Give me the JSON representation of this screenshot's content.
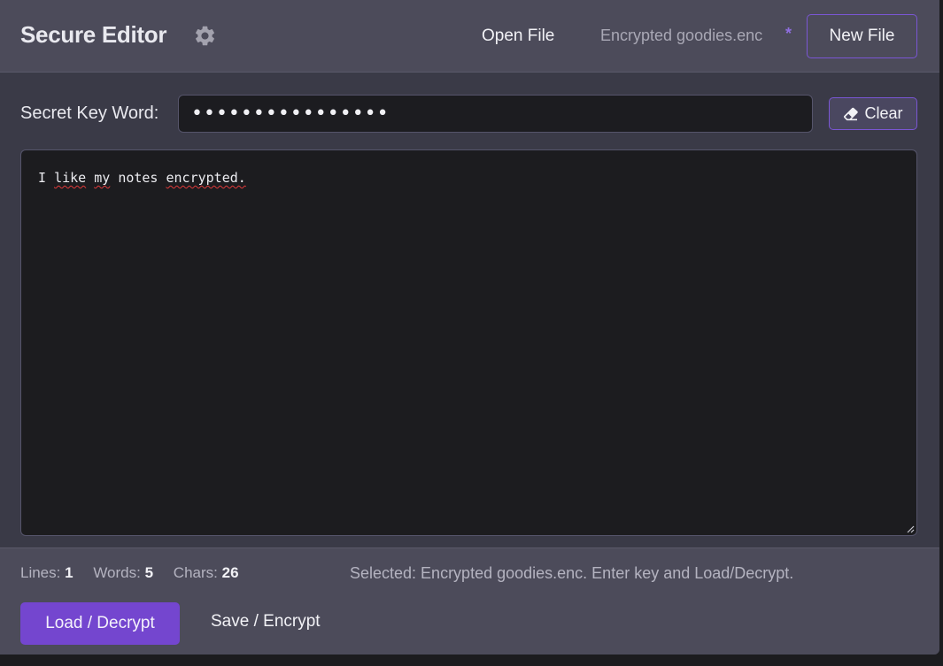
{
  "header": {
    "title": "Secure Editor",
    "settings_icon": "gear-icon",
    "open_file_label": "Open File",
    "current_file": "Encrypted goodies.enc",
    "modified_marker": "*",
    "new_file_label": "New File"
  },
  "key": {
    "label": "Secret Key Word:",
    "value_masked": "••••••••••••••••",
    "clear_label": "Clear",
    "clear_icon": "eraser-icon"
  },
  "editor": {
    "words": [
      "I",
      "like",
      "my",
      "notes",
      "encrypted."
    ],
    "misspelled": [
      "like",
      "my",
      "encrypted"
    ]
  },
  "footer": {
    "lines_label": "Lines:",
    "lines_value": "1",
    "words_label": "Words:",
    "words_value": "5",
    "chars_label": "Chars:",
    "chars_value": "26",
    "status": "Selected: Encrypted goodies.enc. Enter key and Load/Decrypt.",
    "load_label": "Load / Decrypt",
    "save_label": "Save / Encrypt"
  },
  "colors": {
    "accent": "#7446cf",
    "accent_border": "#7a56d4",
    "header_bg": "#4c4b5a",
    "body_bg": "#3a3a47",
    "editor_bg": "#1c1c1f"
  }
}
